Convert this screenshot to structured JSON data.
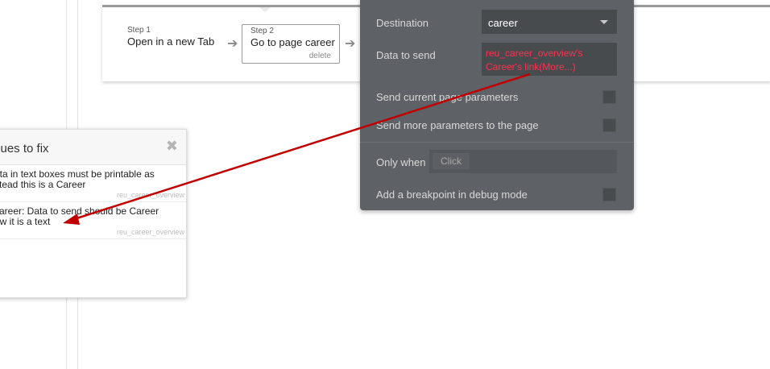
{
  "workflow": {
    "steps": [
      {
        "num": "Step 1",
        "title": "Open in a new Tab"
      },
      {
        "num": "Step 2",
        "title": "Go to page career",
        "delete_label": "delete"
      }
    ]
  },
  "issues_panel": {
    "title": "sues to fix",
    "items": [
      {
        "text_line1": "ata in text boxes must be printable as",
        "text_line2": "stead this is a Career",
        "source": "reu_career_overview"
      },
      {
        "text_line1": " career: Data to send should be Career",
        "text_line2": "ow it is a text",
        "source": "reu_career_overview"
      }
    ]
  },
  "action_panel": {
    "destination_label": "Destination",
    "destination_value": "career",
    "data_to_send_label": "Data to send",
    "data_to_send_line1": "reu_career_overview's",
    "data_to_send_line2": "Career's link(More...)",
    "send_current_label": "Send current page parameters",
    "send_more_label": "Send more parameters to the page",
    "only_when_label": "Only when",
    "only_when_placeholder": "Click",
    "breakpoint_label": "Add a breakpoint in debug mode"
  },
  "colors": {
    "annotation_arrow": "#c00000",
    "error_text": "#ff2f4e",
    "panel_bg": "#5e6266"
  }
}
